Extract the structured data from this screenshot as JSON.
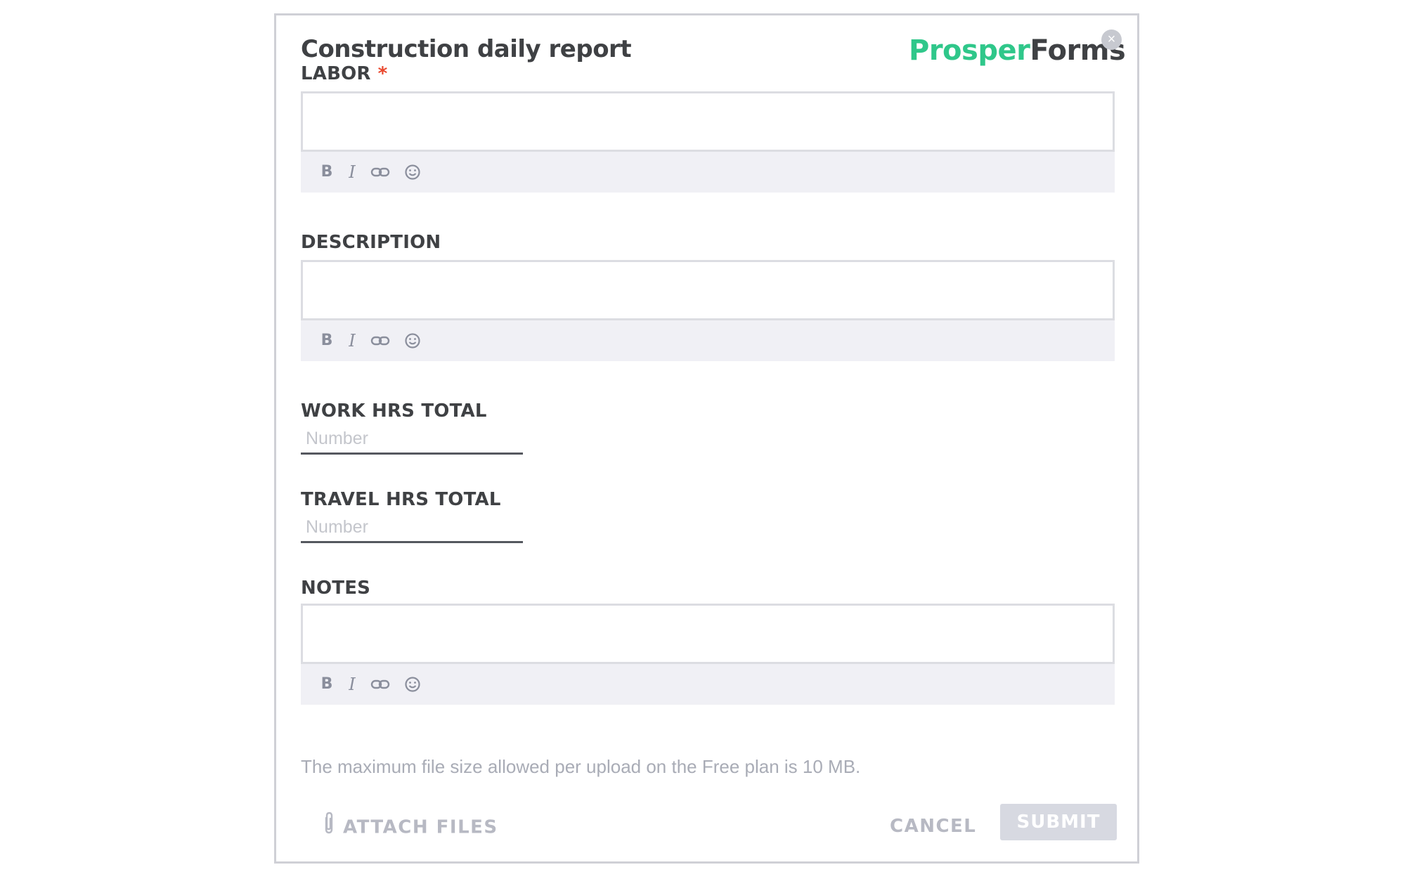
{
  "form": {
    "title": "Construction daily report",
    "close_symbol": "×"
  },
  "brand": {
    "logo_part1": "Prosper",
    "logo_part2": "Forms",
    "accent_color": "#2fc78a",
    "dark_color": "#3f4144"
  },
  "toolbar": {
    "bold_label": "B",
    "italic_label": "I",
    "icons": [
      "bold-icon",
      "italic-icon",
      "link-icon",
      "emoji-icon"
    ]
  },
  "fields": {
    "labor": {
      "label": "LABOR",
      "required_mark": "*"
    },
    "description": {
      "label": "DESCRIPTION"
    },
    "work_hrs_total": {
      "label": "WORK HRS TOTAL",
      "placeholder": "Number"
    },
    "travel_hrs_total": {
      "label": "TRAVEL HRS TOTAL",
      "placeholder": "Number"
    },
    "notes": {
      "label": "NOTES"
    }
  },
  "footer": {
    "info_text": "The maximum file size allowed per upload on the Free plan is 10 MB.",
    "attach_label": "ATTACH FILES",
    "cancel_label": "CANCEL",
    "submit_label": "SUBMIT"
  }
}
